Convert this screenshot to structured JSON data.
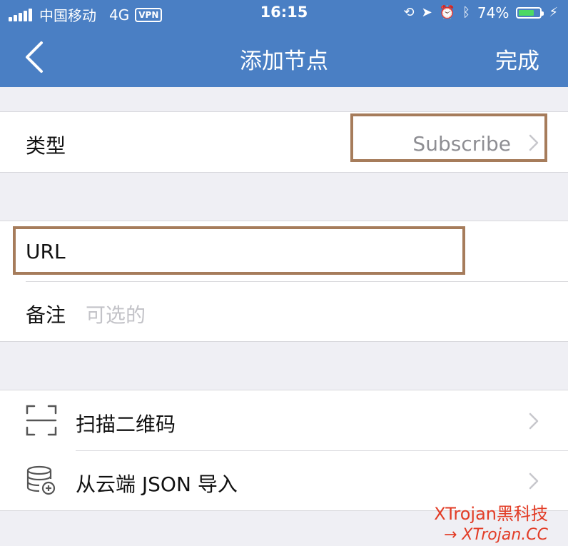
{
  "status_bar": {
    "carrier": "中国移动",
    "network": "4G",
    "vpn": "VPN",
    "time": "16:15",
    "battery": "74%",
    "battery_level": 0.74
  },
  "nav": {
    "title": "添加节点",
    "done_label": "完成"
  },
  "type_row": {
    "label": "类型",
    "value": "Subscribe"
  },
  "url_row": {
    "label": "URL"
  },
  "note_row": {
    "label": "备注",
    "placeholder": "可选的"
  },
  "actions": [
    {
      "label": "扫描二维码"
    },
    {
      "label": "从云端 JSON 导入"
    }
  ],
  "watermark": {
    "line1": "XTrojan黑科技",
    "line2": "→ XTrojan.CC"
  },
  "colors": {
    "nav_blue": "#4a7fc4",
    "highlight": "#a67c5b",
    "watermark": "#e23c26"
  }
}
